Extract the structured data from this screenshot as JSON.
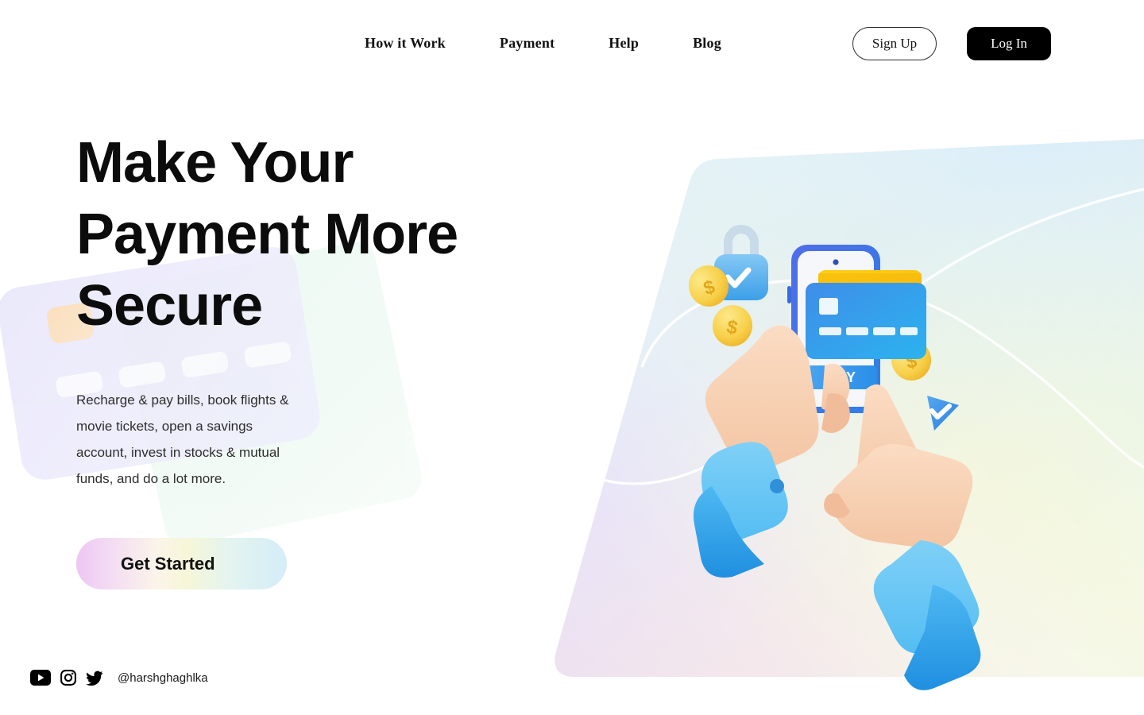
{
  "nav": {
    "links": [
      {
        "label": "How it Work",
        "name": "nav-link-how-it-work"
      },
      {
        "label": "Payment",
        "name": "nav-link-payment"
      },
      {
        "label": "Help",
        "name": "nav-link-help"
      },
      {
        "label": "Blog",
        "name": "nav-link-blog"
      }
    ],
    "signup_label": "Sign Up",
    "login_label": "Log In"
  },
  "hero": {
    "headline": "Make Your Payment More Secure",
    "subtext": "Recharge & pay bills, book flights & movie tickets, open a savings account, invest in stocks & mutual funds, and do a lot more.",
    "cta_label": "Get Started"
  },
  "illustration": {
    "pay_button_label": "PAY",
    "icons": [
      "padlock-check-icon",
      "coin-dollar-icon",
      "credit-card-icon",
      "smartphone-icon",
      "check-badge-icon",
      "hand-icon"
    ]
  },
  "social": {
    "handle": "@harshghaghlka",
    "links": [
      {
        "name": "youtube-icon",
        "label": "YouTube"
      },
      {
        "name": "instagram-icon",
        "label": "Instagram"
      },
      {
        "name": "twitter-icon",
        "label": "Twitter"
      }
    ]
  },
  "colors": {
    "text": "#0c0c0c",
    "login_bg": "#000000",
    "card_blue": "#2f9bee",
    "card_yellow": "#fcc521",
    "coin_gold": "#f7cf45",
    "panel_pink": "#efd3f6",
    "panel_blue": "#d6eefb",
    "panel_mint": "#ebf7e4"
  }
}
